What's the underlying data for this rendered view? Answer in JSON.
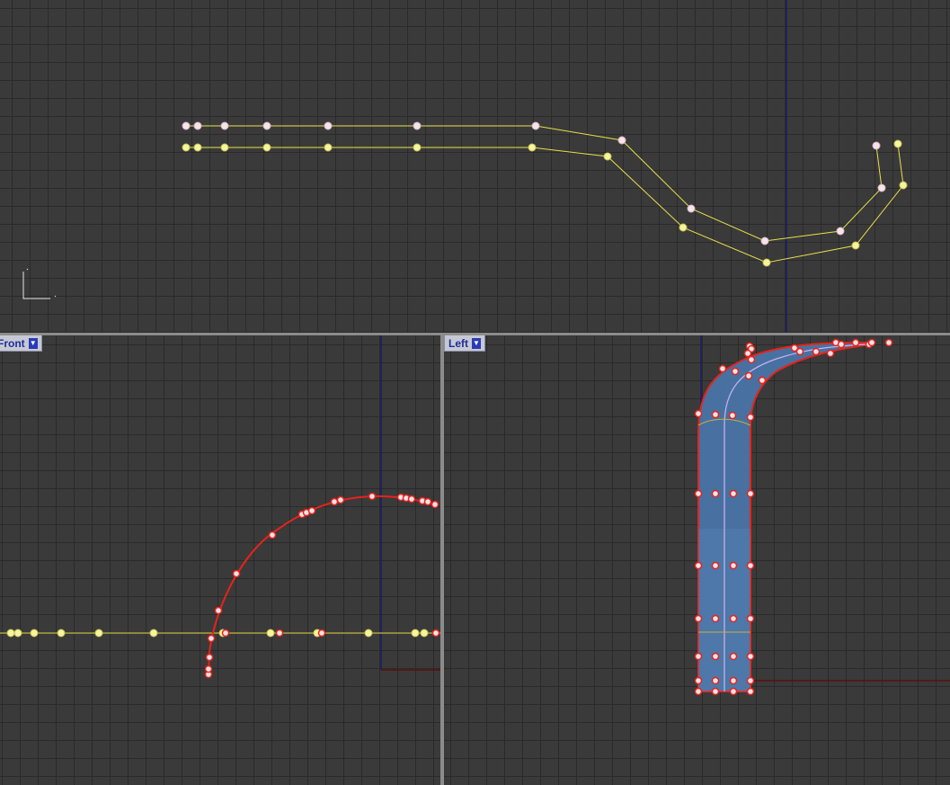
{
  "viewports": {
    "front": {
      "label": "Front",
      "menu_icon": "dropdown-arrow-icon"
    },
    "left": {
      "label": "Left",
      "menu_icon": "dropdown-arrow-icon"
    },
    "top": {
      "axis_icon": "axis-indicator-icon"
    }
  },
  "colors": {
    "background": "#3a3a3a",
    "grid_minor": "#2a2a2a",
    "curve_yellow": "#e8e04a",
    "point_yellow": "#f5f5a0",
    "point_pink": "#f6e4ea",
    "selected_red": "#e8231a",
    "surface_blue": "#4a78ad",
    "axis_blue": "#1c1c6a",
    "axis_red": "#5a1010"
  }
}
